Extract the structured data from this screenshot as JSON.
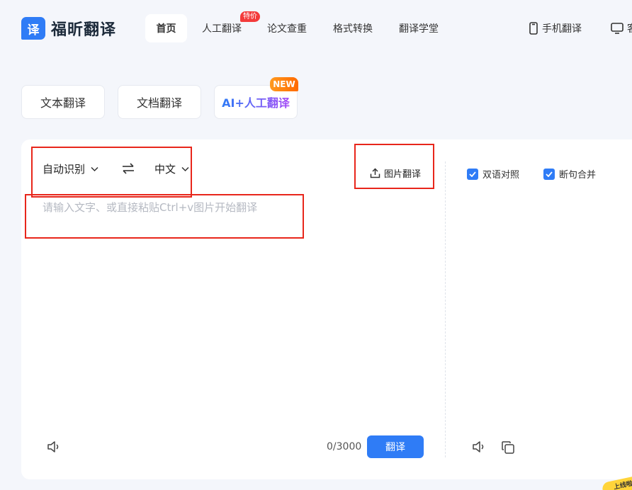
{
  "brand": {
    "logo_glyph": "译",
    "name": "福昕翻译",
    "accent": "#2f7cf6"
  },
  "nav": {
    "items": [
      {
        "label": "首页",
        "active": true
      },
      {
        "label": "人工翻译",
        "badge": "特价"
      },
      {
        "label": "论文查重"
      },
      {
        "label": "格式转换"
      },
      {
        "label": "翻译学堂"
      }
    ],
    "right": [
      {
        "label": "手机翻译",
        "icon": "phone-icon"
      },
      {
        "label": "客",
        "icon": "monitor-icon"
      }
    ]
  },
  "tabs": [
    {
      "label": "文本翻译"
    },
    {
      "label": "文档翻译"
    },
    {
      "label": "AI+人工翻译",
      "badge": "NEW"
    }
  ],
  "translator": {
    "source_lang": "自动识别",
    "target_lang": "中文",
    "image_translate": "图片翻译",
    "input_placeholder": "请输入文字、或直接粘贴Ctrl+v图片开始翻译",
    "char_count": "0/3000",
    "translate_button": "翻译",
    "options": [
      {
        "label": "双语对照",
        "checked": true
      },
      {
        "label": "断句合并",
        "checked": true
      }
    ]
  },
  "corner_badge": "上线啦"
}
